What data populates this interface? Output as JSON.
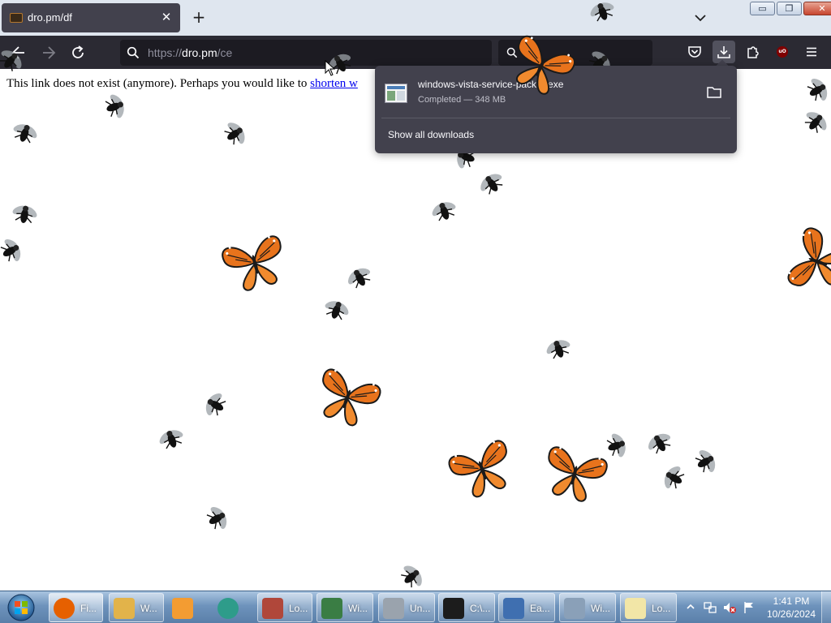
{
  "tab": {
    "title": "dro.pm/df",
    "close_glyph": "✕"
  },
  "new_tab_glyph": "+",
  "window_controls": {
    "minimize": "▭",
    "restore": "❐",
    "close": "✕"
  },
  "urlbar": {
    "scheme": "https://",
    "host": "dro.pm",
    "path": "/ce"
  },
  "page": {
    "message": "This link does not exist (anymore). Perhaps you would like to ",
    "link_text": "shorten w"
  },
  "downloads": {
    "file_name": "windows-vista-service-pack-2.exe",
    "status": "Completed — 348 MB",
    "show_all": "Show all downloads"
  },
  "taskbar": {
    "items": [
      {
        "label": "Fi...",
        "icon": "firefox-icon",
        "color": "#e66000"
      },
      {
        "label": "W...",
        "icon": "explorer-folder-icon",
        "color": "#e2b34a"
      },
      {
        "label": "",
        "icon": "media-player-icon",
        "color": "#f39c32"
      },
      {
        "label": "",
        "icon": "messenger-icon",
        "color": "#2e9c8a"
      },
      {
        "label": "Lo...",
        "icon": "installer-icon",
        "color": "#b0473a"
      },
      {
        "label": "Wi...",
        "icon": "windows-app-icon",
        "color": "#3a7d44"
      },
      {
        "label": "Un...",
        "icon": "uninstall-icon",
        "color": "#9aa3ad"
      },
      {
        "label": "C:\\...",
        "icon": "7zip-icon",
        "color": "#1c1c1c"
      },
      {
        "label": "Ea...",
        "icon": "easy-transfer-icon",
        "color": "#3f6fb0"
      },
      {
        "label": "Wi...",
        "icon": "windows-update-icon",
        "color": "#8aa0b8"
      },
      {
        "label": "Lo...",
        "icon": "notepad-icon",
        "color": "#f2e6a7"
      }
    ],
    "clock_time": "1:41 PM",
    "clock_date": "10/26/2024"
  },
  "colors": {
    "tab_bg": "#42414d",
    "navbar_bg": "#2b2a33",
    "urlbar_bg": "#1c1b22",
    "panel_bg": "#42414d",
    "link": "#0000ee",
    "butterfly": "#e8731c"
  }
}
